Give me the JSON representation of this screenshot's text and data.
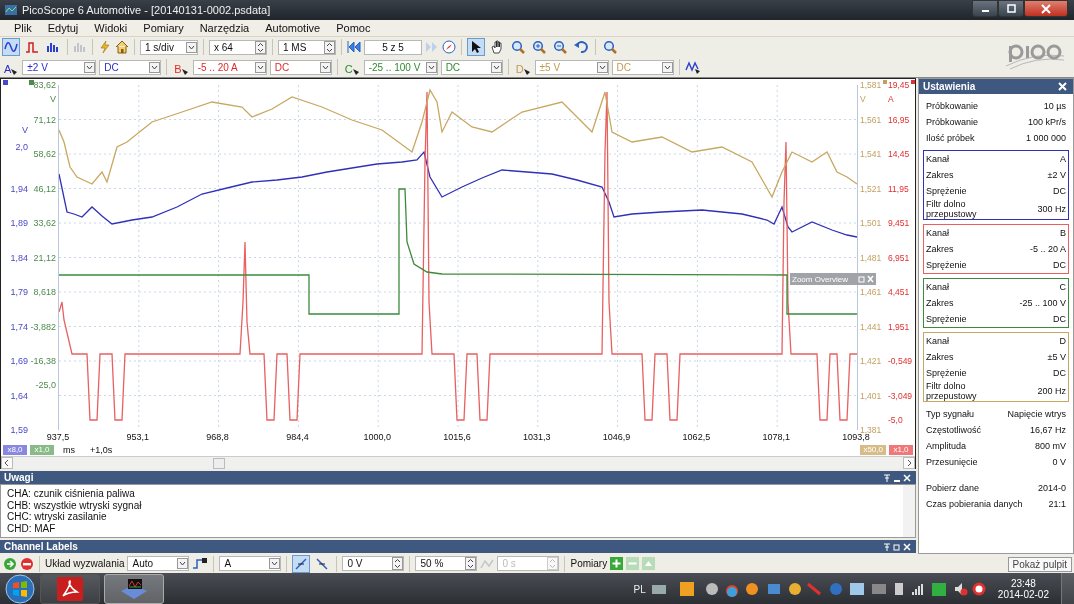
{
  "window": {
    "title": "PicoScope 6 Automotive - [20140131-0002.psdata]"
  },
  "menu": [
    "Plik",
    "Edytuj",
    "Widoki",
    "Pomiary",
    "Narzędzia",
    "Automotive",
    "Pomoc"
  ],
  "toolbar": {
    "view_modes": [
      {
        "selected": true
      },
      {
        "selected": false
      },
      {
        "selected": false
      }
    ],
    "timebase": "1 s/div",
    "zoom": "x 64",
    "samples": "1 MS",
    "buffer": "5 z 5",
    "tools": [
      {
        "selected": true
      },
      {
        "selected": false
      },
      {
        "selected": false
      },
      {
        "selected": false
      },
      {
        "selected": false
      },
      {
        "selected": false
      },
      {
        "selected": false
      }
    ]
  },
  "channel_bar": [
    {
      "letter": "A",
      "color": "#2c2cc8",
      "range": "±2 V",
      "coupling": "DC"
    },
    {
      "letter": "B",
      "color": "#e02828",
      "range": "-5 .. 20 A",
      "coupling": "DC"
    },
    {
      "letter": "C",
      "color": "#2e8a2e",
      "range": "-25 .. 100 V",
      "coupling": "DC"
    },
    {
      "letter": "D",
      "color": "#c09a50",
      "range": "±5 V",
      "coupling": "DC"
    }
  ],
  "scope": {
    "axes": [
      {
        "color": "#4848c8",
        "labels": [
          "V",
          "2,0",
          "1,94",
          "1,89",
          "1,84",
          "1,79",
          "1,74",
          "1,69",
          "1,64",
          "1,59"
        ]
      },
      {
        "color": "#4e8a4e",
        "labels": [
          "83,62",
          "V",
          "71,12",
          "58,62",
          "46,12",
          "33,62",
          "21,12",
          "8,618",
          "-3,882",
          "-16,38",
          "-25,0"
        ]
      },
      {
        "color": "#c0a060",
        "labels": [
          "1,581",
          "V",
          "1,561",
          "1,541",
          "1,521",
          "1,501",
          "1,481",
          "1,461",
          "1,441",
          "1,421",
          "1,401",
          "1,381"
        ]
      },
      {
        "color": "#e03030",
        "labels": [
          "19,45",
          "A",
          "16,95",
          "14,45",
          "11,95",
          "9,451",
          "6,951",
          "4,451",
          "1,951",
          "-0,549",
          "-3,049",
          "-5,0"
        ]
      }
    ],
    "x_ticks": [
      "937,5",
      "953,1",
      "968,8",
      "984,4",
      "1000,0",
      "1015,6",
      "1031,3",
      "1046,9",
      "1062,5",
      "1078,1",
      "1093,8"
    ],
    "x_unit": "ms",
    "offset": "+1,0s",
    "scale_badges": [
      {
        "text": "x8,0",
        "color": "#8888e0"
      },
      {
        "text": "x1,0",
        "color": "#88bb88"
      },
      {
        "text": "x50,0",
        "color": "#d8bc88"
      },
      {
        "text": "x1,0",
        "color": "#f07878"
      }
    ],
    "overlay": {
      "title": "Zoom Overview"
    }
  },
  "settings": {
    "title": "Ustawienia",
    "general": [
      {
        "label": "Próbkowanie",
        "value": "10 µs"
      },
      {
        "label": "Próbkowanie",
        "value": "100 kPr/s"
      },
      {
        "label": "Ilość próbek",
        "value": "1 000 000"
      }
    ],
    "channels": [
      {
        "color": "#3030b8",
        "rows": [
          {
            "label": "Kanał",
            "value": "A"
          },
          {
            "label": "Zakres",
            "value": "±2 V"
          },
          {
            "label": "Sprężenie",
            "value": "DC"
          },
          {
            "label": "Filtr dolno przepustowy",
            "value": "300 Hz"
          }
        ]
      },
      {
        "color": "#e86060",
        "rows": [
          {
            "label": "Kanał",
            "value": "B"
          },
          {
            "label": "Zakres",
            "value": "-5 .. 20 A"
          },
          {
            "label": "Sprężenie",
            "value": "DC"
          }
        ]
      },
      {
        "color": "#3c8a3c",
        "rows": [
          {
            "label": "Kanał",
            "value": "C"
          },
          {
            "label": "Zakres",
            "value": "-25 .. 100 V"
          },
          {
            "label": "Sprężenie",
            "value": "DC"
          }
        ]
      },
      {
        "color": "#c8a860",
        "rows": [
          {
            "label": "Kanał",
            "value": "D"
          },
          {
            "label": "Zakres",
            "value": "±5 V"
          },
          {
            "label": "Sprężenie",
            "value": "DC"
          },
          {
            "label": "Filtr dolno przepustowy",
            "value": "200 Hz"
          }
        ]
      }
    ],
    "signal": [
      {
        "label": "Typ sygnału",
        "value": "Napięcie wtrys"
      },
      {
        "label": "Częstotliwość",
        "value": "16,67 Hz"
      },
      {
        "label": "Amplituda",
        "value": "800 mV"
      },
      {
        "label": "Przesunięcie",
        "value": "0 V"
      }
    ],
    "capture": [
      {
        "label": "Pobierz dane",
        "value": "2014-0"
      },
      {
        "label": "Czas pobierania danych",
        "value": "21:1"
      }
    ]
  },
  "notes": {
    "title": "Uwagi",
    "lines": [
      "CHA: czunik ciśnienia paliwa",
      "CHB: wszystkie wtryski sygnał",
      "CHC: wtryski zasilanie",
      "CHD: MAF"
    ]
  },
  "channel_labels": {
    "title": "Channel Labels"
  },
  "trigger_bar": {
    "label": "Układ wyzwalania",
    "mode": "Auto",
    "source": "A",
    "edges": [
      {
        "selected": true
      },
      {
        "selected": false
      }
    ],
    "threshold": "0 V",
    "pretrigger": "50 %",
    "delay": "0 s",
    "measurements": "Pomiary"
  },
  "tooltip": "Pokaż pulpit",
  "taskbar": {
    "apps": [
      {
        "selected": false
      },
      {
        "selected": true
      }
    ],
    "language": "PL",
    "time": "23:48",
    "date": "2014-02-02"
  }
}
